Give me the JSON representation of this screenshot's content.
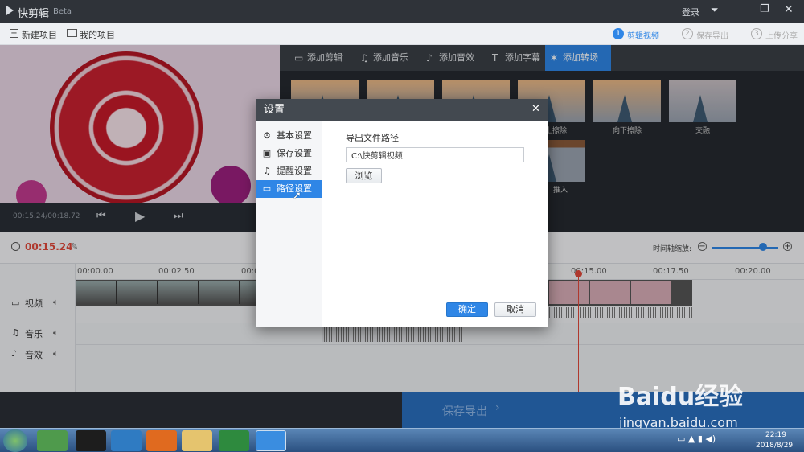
{
  "app": {
    "name": "快剪辑",
    "badge": "Beta",
    "login": "登录"
  },
  "toolbar": {
    "new_project": "新建项目",
    "my_projects": "我的项目",
    "steps": [
      {
        "num": "1",
        "label": "剪辑视频"
      },
      {
        "num": "2",
        "label": "保存导出"
      },
      {
        "num": "3",
        "label": "上传分享"
      }
    ]
  },
  "player": {
    "time": "00:15.24/00:18.72"
  },
  "tabs": [
    "添加剪辑",
    "添加音乐",
    "添加音效",
    "添加字幕",
    "添加转场"
  ],
  "transitions": [
    "上擦除",
    "向下擦除",
    "交融",
    "推入"
  ],
  "timeline": {
    "current": "00:15.24",
    "zoom_label": "时间轴缩放:",
    "zoom_level": 0.86,
    "ticks": [
      "00:00.00",
      "00:02.50",
      "00:05.00",
      "00:15.00",
      "00:17.50",
      "00:20.00"
    ]
  },
  "tracks": {
    "video": "视频",
    "music": "音乐",
    "sfx": "音效"
  },
  "export_button": "保存导出",
  "dialog": {
    "title": "设置",
    "menu": [
      "基本设置",
      "保存设置",
      "提醒设置",
      "路径设置"
    ],
    "selected": 3,
    "path_label": "导出文件路径",
    "path_value": "C:\\快剪辑视频",
    "browse": "浏览",
    "ok": "确定",
    "cancel": "取消"
  },
  "taskbar": {
    "time": "22:19",
    "date": "2018/8/29"
  },
  "watermark": {
    "brand": "Baidu经验",
    "url": "jingyan.baidu.com"
  }
}
